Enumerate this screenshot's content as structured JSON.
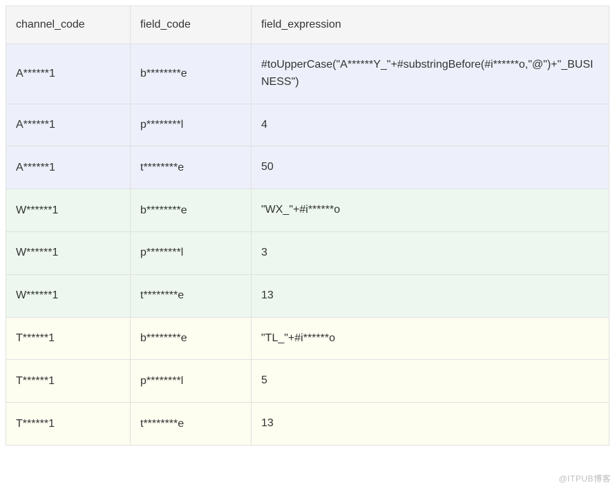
{
  "table": {
    "headers": {
      "channel_code": "channel_code",
      "field_code": "field_code",
      "field_expression": "field_expression"
    },
    "rows": [
      {
        "group": "a",
        "channel_code": "A******1",
        "field_code": "b********e",
        "field_expression": "#toUpperCase(\"A******Y_\"+#substringBefore(#i******o,\"@\")+\"_BUSINESS\")"
      },
      {
        "group": "a",
        "channel_code": "A******1",
        "field_code": "p********l",
        "field_expression": "4"
      },
      {
        "group": "a",
        "channel_code": "A******1",
        "field_code": "t********e",
        "field_expression": "50"
      },
      {
        "group": "w",
        "channel_code": "W******1",
        "field_code": "b********e",
        "field_expression": "\"WX_\"+#i******o"
      },
      {
        "group": "w",
        "channel_code": "W******1",
        "field_code": "p********l",
        "field_expression": "3"
      },
      {
        "group": "w",
        "channel_code": "W******1",
        "field_code": "t********e",
        "field_expression": "13"
      },
      {
        "group": "t",
        "channel_code": "T******1",
        "field_code": "b********e",
        "field_expression": "\"TL_\"+#i******o"
      },
      {
        "group": "t",
        "channel_code": "T******1",
        "field_code": "p********l",
        "field_expression": "5"
      },
      {
        "group": "t",
        "channel_code": "T******1",
        "field_code": "t********e",
        "field_expression": "13"
      }
    ]
  },
  "watermark": "@ITPUB博客"
}
